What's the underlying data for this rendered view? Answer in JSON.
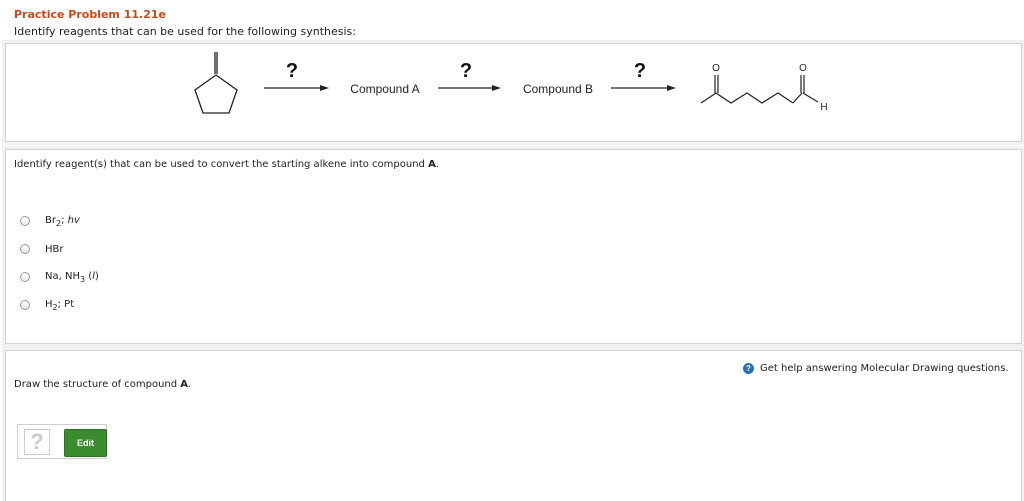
{
  "header": {
    "title": "Practice Problem 11.21e",
    "instructions": "Identify reagents that can be used for the following synthesis:"
  },
  "scheme": {
    "arrow_labels": [
      "?",
      "?",
      "?"
    ],
    "compound_a": "Compound A",
    "compound_b": "Compound B",
    "product_atoms": {
      "o1": "O",
      "o2": "O",
      "h": "H"
    }
  },
  "question1": {
    "prompt_pre": "Identify reagent(s) that can be used to convert the starting alkene into compound ",
    "prompt_bold": "A",
    "prompt_post": ".",
    "options": [
      {
        "main": "Br",
        "sub": "2",
        "rest": "; ",
        "ital": "hv",
        "tail": ""
      },
      {
        "main": "HBr",
        "sub": "",
        "rest": "",
        "ital": "",
        "tail": ""
      },
      {
        "main": "Na, NH",
        "sub": "3",
        "rest": " (",
        "ital": "l",
        "tail": ")"
      },
      {
        "main": "H",
        "sub": "2",
        "rest": "; Pt",
        "ital": "",
        "tail": ""
      }
    ]
  },
  "question2": {
    "help_icon": "?",
    "help_text": "Get help answering Molecular Drawing questions.",
    "prompt_pre": "Draw the structure of compound ",
    "prompt_bold": "A",
    "prompt_post": ".",
    "placeholder": "?",
    "edit_label": "Edit"
  }
}
